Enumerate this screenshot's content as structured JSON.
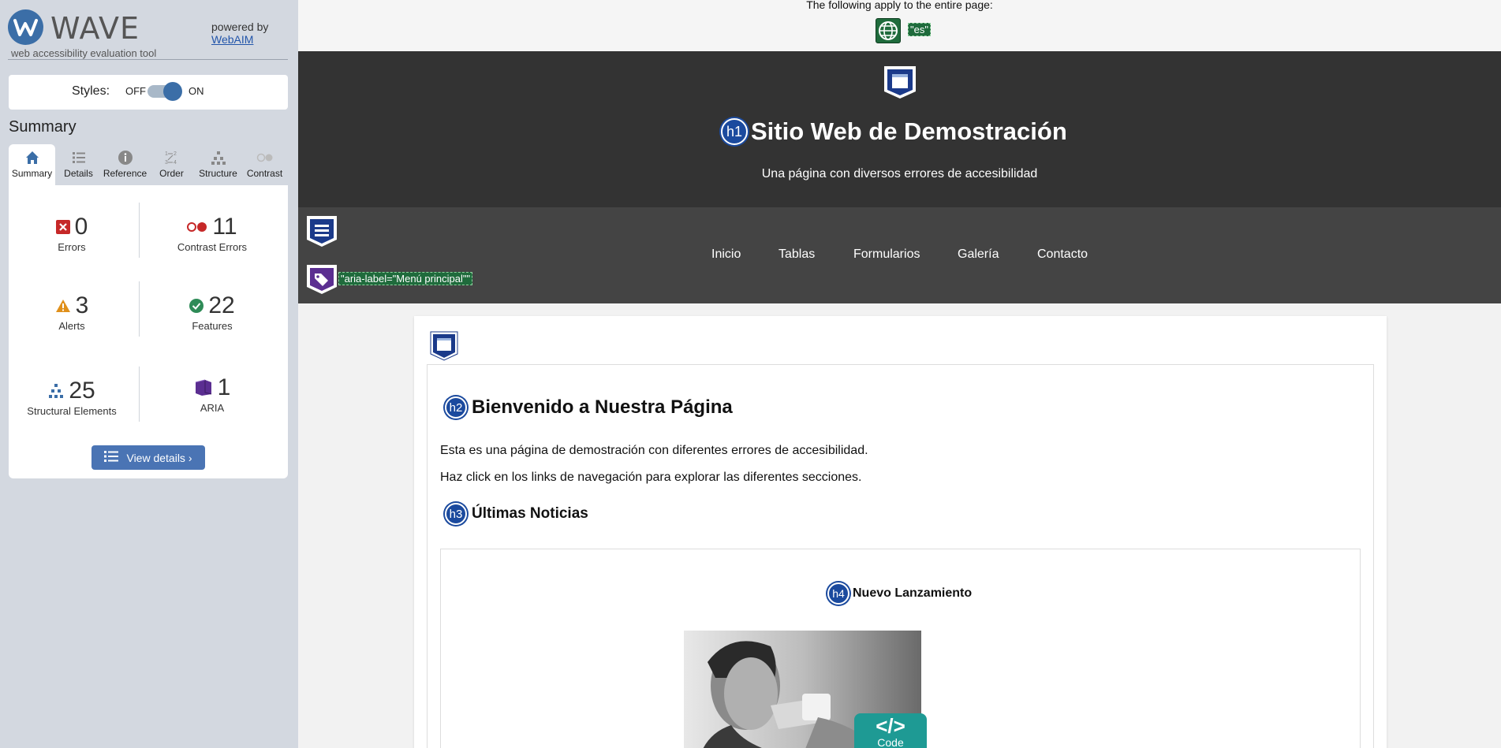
{
  "sidebar": {
    "brand": {
      "name": "WAVE",
      "tagline": "web accessibility evaluation tool",
      "powered_by": "powered by",
      "powered_link": "WebAIM"
    },
    "styles": {
      "label": "Styles:",
      "off": "OFF",
      "on": "ON",
      "state": "on"
    },
    "summary_title": "Summary",
    "tabs": [
      {
        "label": "Summary",
        "icon": "home-icon",
        "active": true
      },
      {
        "label": "Details",
        "icon": "list-icon",
        "active": false
      },
      {
        "label": "Reference",
        "icon": "info-icon",
        "active": false
      },
      {
        "label": "Order",
        "icon": "order-icon",
        "active": false
      },
      {
        "label": "Structure",
        "icon": "structure-icon",
        "active": false
      },
      {
        "label": "Contrast",
        "icon": "contrast-icon",
        "active": false
      }
    ],
    "stats": {
      "errors": {
        "value": "0",
        "label": "Errors",
        "icon": "error-icon"
      },
      "contrast_errors": {
        "value": "11",
        "label": "Contrast Errors",
        "icon": "contrast-error-icon"
      },
      "alerts": {
        "value": "3",
        "label": "Alerts",
        "icon": "alert-icon"
      },
      "features": {
        "value": "22",
        "label": "Features",
        "icon": "feature-icon"
      },
      "structural": {
        "value": "25",
        "label": "Structural Elements",
        "icon": "structure-icon"
      },
      "aria": {
        "value": "1",
        "label": "ARIA",
        "icon": "aria-icon"
      }
    },
    "view_details": "View details ›"
  },
  "page": {
    "notice": "The following apply to the entire page:",
    "lang_tag": "\"es\"",
    "header": {
      "h1_badge": "h1",
      "title": "Sitio Web de Demostración",
      "subtitle": "Una página con diversos errores de accesibilidad"
    },
    "nav": {
      "aria_label_tag": "\"aria-label=\"Menú principal\"\"",
      "links": [
        "Inicio",
        "Tablas",
        "Formularios",
        "Galería",
        "Contacto"
      ]
    },
    "main": {
      "h2_badge": "h2",
      "heading": "Bienvenido a Nuestra Página",
      "paragraphs": [
        "Esta es una página de demostración con diferentes errores de accesibilidad.",
        "Haz click en los links de navegación para explorar las diferentes secciones."
      ],
      "h3_badge": "h3",
      "news_heading": "Últimas Noticias",
      "article": {
        "h4_badge": "h4",
        "title": "Nuevo Lanzamiento"
      }
    },
    "code_tab": {
      "symbol": "</>",
      "label": "Code"
    }
  },
  "colors": {
    "sidebar_bg": "#d3d8e0",
    "accent_blue": "#4a74b4",
    "header_bg": "#333333",
    "nav_bg": "#444444",
    "feature_green": "#1f6b3c",
    "heading_badge": "#1b4a9e",
    "aria_purple": "#5b2e91",
    "code_teal": "#1e9a94"
  }
}
